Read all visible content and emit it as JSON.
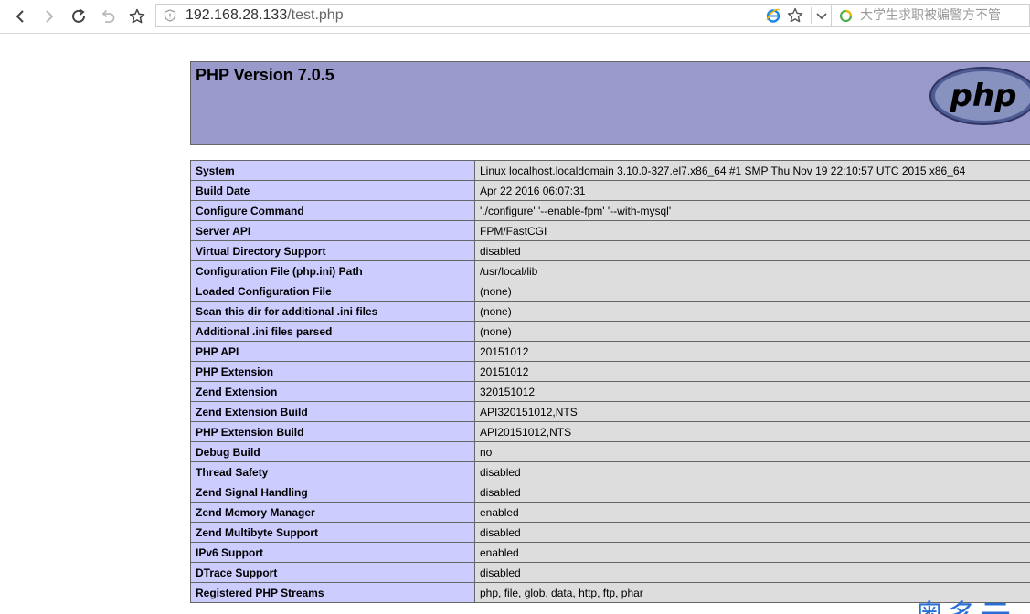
{
  "browser": {
    "url_host": "192.168.28.133",
    "url_path": "/test.php",
    "search_placeholder": "大学生求职被骗警方不管",
    "icons": [
      "back-icon",
      "forward-icon",
      "refresh-icon",
      "undo-icon",
      "bookmark-star-icon",
      "security-shield-icon",
      "ie-compat-icon",
      "favorite-star-icon",
      "dropdown-icon",
      "search-engine-icon"
    ]
  },
  "header": {
    "title": "PHP Version 7.0.5",
    "logo": "php"
  },
  "info_rows": [
    {
      "key": "System",
      "value": "Linux localhost.localdomain 3.10.0-327.el7.x86_64 #1 SMP Thu Nov 19 22:10:57 UTC 2015 x86_64"
    },
    {
      "key": "Build Date",
      "value": "Apr 22 2016 06:07:31"
    },
    {
      "key": "Configure Command",
      "value": "'./configure' '--enable-fpm' '--with-mysql'"
    },
    {
      "key": "Server API",
      "value": "FPM/FastCGI"
    },
    {
      "key": "Virtual Directory Support",
      "value": "disabled"
    },
    {
      "key": "Configuration File (php.ini) Path",
      "value": "/usr/local/lib"
    },
    {
      "key": "Loaded Configuration File",
      "value": "(none)"
    },
    {
      "key": "Scan this dir for additional .ini files",
      "value": "(none)"
    },
    {
      "key": "Additional .ini files parsed",
      "value": "(none)"
    },
    {
      "key": "PHP API",
      "value": "20151012"
    },
    {
      "key": "PHP Extension",
      "value": "20151012"
    },
    {
      "key": "Zend Extension",
      "value": "320151012"
    },
    {
      "key": "Zend Extension Build",
      "value": "API320151012,NTS"
    },
    {
      "key": "PHP Extension Build",
      "value": "API20151012,NTS"
    },
    {
      "key": "Debug Build",
      "value": "no"
    },
    {
      "key": "Thread Safety",
      "value": "disabled"
    },
    {
      "key": "Zend Signal Handling",
      "value": "disabled"
    },
    {
      "key": "Zend Memory Manager",
      "value": "enabled"
    },
    {
      "key": "Zend Multibyte Support",
      "value": "disabled"
    },
    {
      "key": "IPv6 Support",
      "value": "enabled"
    },
    {
      "key": "DTrace Support",
      "value": "disabled"
    },
    {
      "key": "Registered PHP Streams",
      "value": "php, file, glob, data, http, ftp, phar"
    }
  ],
  "colors": {
    "header_bg": "#9999cc",
    "key_cell_bg": "#ccccff",
    "value_cell_bg": "#dddddd",
    "border": "#666666",
    "watermark": "#2a6fd6"
  },
  "watermark": "奥多云"
}
